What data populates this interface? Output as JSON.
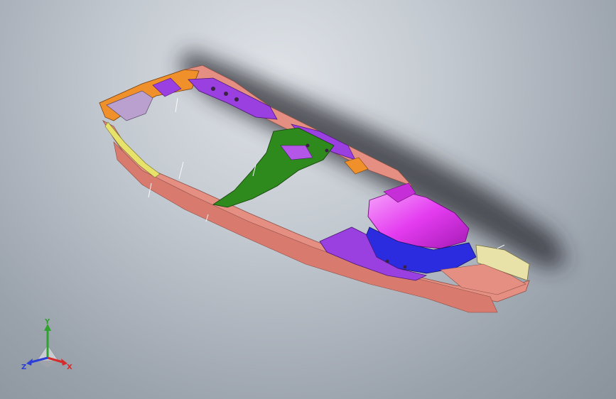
{
  "viewport": {
    "background_top": "#dfe3e8",
    "background_bottom": "#8a929c",
    "model_colors": {
      "salmon": "#e58f83",
      "orange": "#f0902a",
      "purple": "#9a3fe0",
      "green": "#2e8a1c",
      "magenta": "#e43cf0",
      "blue": "#2b2ce0",
      "yellow": "#e6e26a",
      "lavender": "#b9a0cf"
    }
  },
  "triad": {
    "x_label": "X",
    "y_label": "Y",
    "z_label": "Z",
    "x_color": "#d62b2b",
    "y_color": "#2ea32e",
    "z_color": "#2b3fd6"
  }
}
